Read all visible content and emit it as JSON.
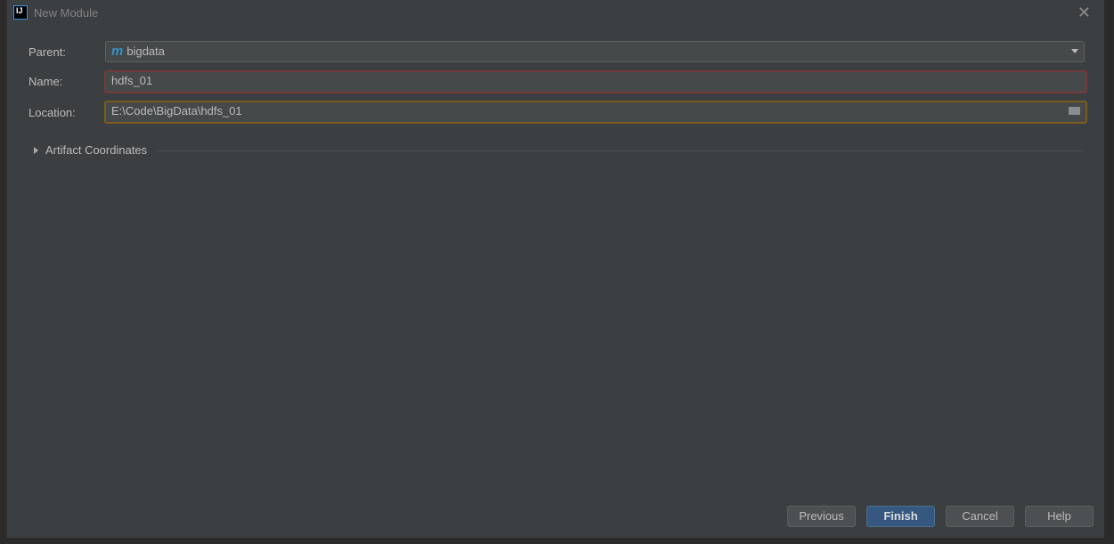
{
  "dialog": {
    "title": "New Module",
    "close_icon": "close-icon",
    "logo": "IJ"
  },
  "form": {
    "parent_label": "Parent:",
    "parent_value": "bigdata",
    "parent_icon": "m",
    "name_label": "Name:",
    "name_value": "hdfs_01",
    "location_label": "Location:",
    "location_value": "E:\\Code\\BigData\\hdfs_01"
  },
  "artifact": {
    "label": "Artifact Coordinates"
  },
  "buttons": {
    "previous": "Previous",
    "finish": "Finish",
    "cancel": "Cancel",
    "help": "Help"
  },
  "colors": {
    "primary_button": "#365880",
    "error_border": "#743a3a",
    "warning_border": "#7a5b1e"
  }
}
